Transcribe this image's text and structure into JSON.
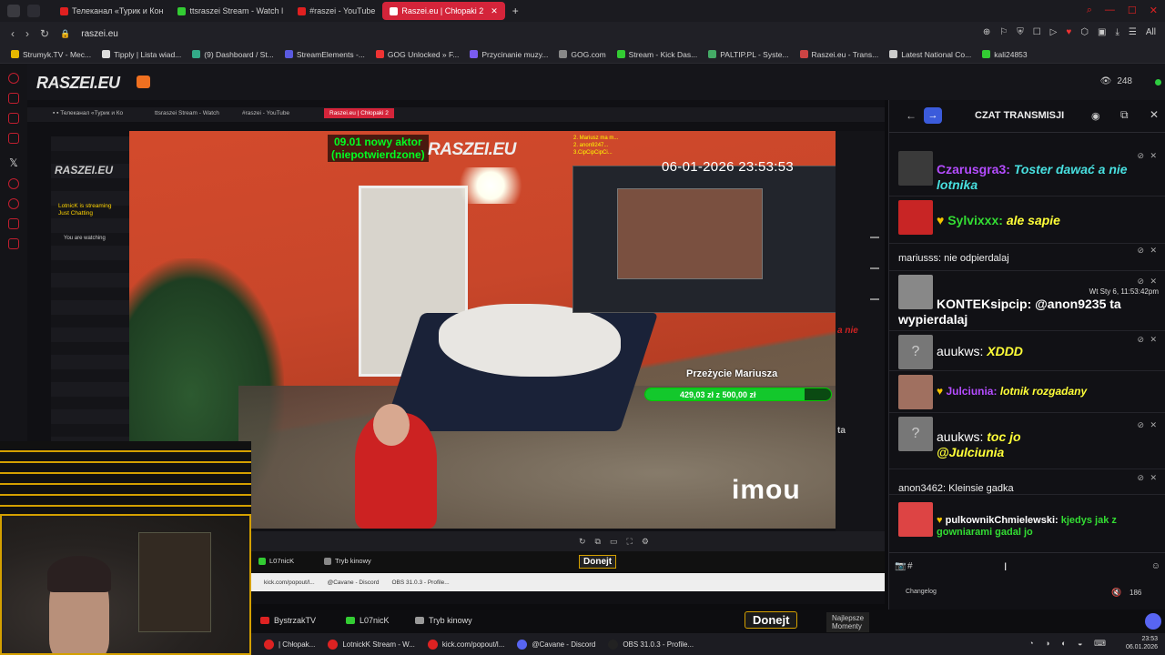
{
  "browser": {
    "tabs": [
      {
        "label": "Телеканал «Турик и Кон"
      },
      {
        "label": "ttsraszei Stream - Watch l"
      },
      {
        "label": "#raszei - YouTube"
      },
      {
        "label": "Raszei.eu | Chłopaki 2"
      }
    ],
    "url": "raszei.eu",
    "bookmarks": [
      "Strumyk.TV - Mec...",
      "Tipply | Lista wiad...",
      "(9) Dashboard / St...",
      "StreamElements -...",
      "GOG Unlocked » F...",
      "Przycinanie muzy...",
      "GOG.com",
      "Stream - Kick Das...",
      "PALTIP.PL - Syste...",
      "Raszei.eu - Trans...",
      "Latest National Co...",
      "kali24853"
    ],
    "all_label": "All"
  },
  "header": {
    "logo": "RASZEI.EU",
    "viewers": "248"
  },
  "player": {
    "inner": {
      "logo": "RASZEI.EU",
      "streaming": "LotnicK is streaming",
      "category": "Just Chatting",
      "watching": "You are watching"
    },
    "overlay_line1": "09.01 nowy aktor",
    "overlay_line2": "(niepotwierdzone)",
    "overlay_logo": "RASZEI.EU",
    "timestamp": "06-01-2026 23:53:53",
    "goal_title": "Przeżycie Mariusza",
    "goal_text": "429,03 zł z 500,00 zł",
    "goal_progress": 0.86,
    "brand": "imou",
    "inner_chat_snip": "a nie",
    "inner_chat_snip2": "ta",
    "mini_donejt": "Donejt",
    "mini_tabs": [
      "BystrzakTV",
      "L07nicK",
      "Tryb kinowy"
    ],
    "mini_task": [
      "kick.com/popout/l...",
      "@Cavane - Discord",
      "OBS 31.0.3 - Profile..."
    ]
  },
  "chat": {
    "title": "CZAT TRANSMISJI",
    "messages": [
      {
        "user": "Czarusgra3:",
        "text": "Toster dawać a nie lotnika",
        "user_color": "#b44cff"
      },
      {
        "user": "Sylvixxx:",
        "text": "ale  sapie",
        "user_color": "#33dd33"
      },
      {
        "user": "mariusss:",
        "text": "nie odpierdalaj"
      },
      {
        "user": "KONTEKsipcip:",
        "text": "@anon9235 ta wypierdalaj",
        "timestamp": "Wt Sty 6, 11:53:42pm",
        "user_color": "#8a2be2"
      },
      {
        "user": "auukws:",
        "text": "XDDD"
      },
      {
        "user": "Julciunia:",
        "text": "lotnik rozgadany",
        "user_color": "#b44cff"
      },
      {
        "user": "auukws:",
        "text": "toc jo @Julciunia"
      },
      {
        "user": "anon3462:",
        "text": "Kleinsie gadka"
      },
      {
        "user": "pulkownikChmielewski:",
        "text": "kjedys jak z gowniarami gadal jo",
        "user_color": "#33dd33"
      }
    ],
    "changelog": "Changelog",
    "volume_value": "186"
  },
  "bottom_panel": {
    "tabs": [
      "BystrzakTV",
      "L07nicK",
      "Tryb kinowy"
    ],
    "donejt": "Donejt",
    "najlepsze_line1": "Najlepsze",
    "najlepsze_line2": "Momenty"
  },
  "taskbar": {
    "items": [
      "| Chłopak...",
      "LotnickK Stream - W...",
      "kick.com/popout/l...",
      "@Cavane - Discord",
      "OBS 31.0.3 - Profile..."
    ],
    "time": "23:53",
    "date": "06.01.2026"
  }
}
